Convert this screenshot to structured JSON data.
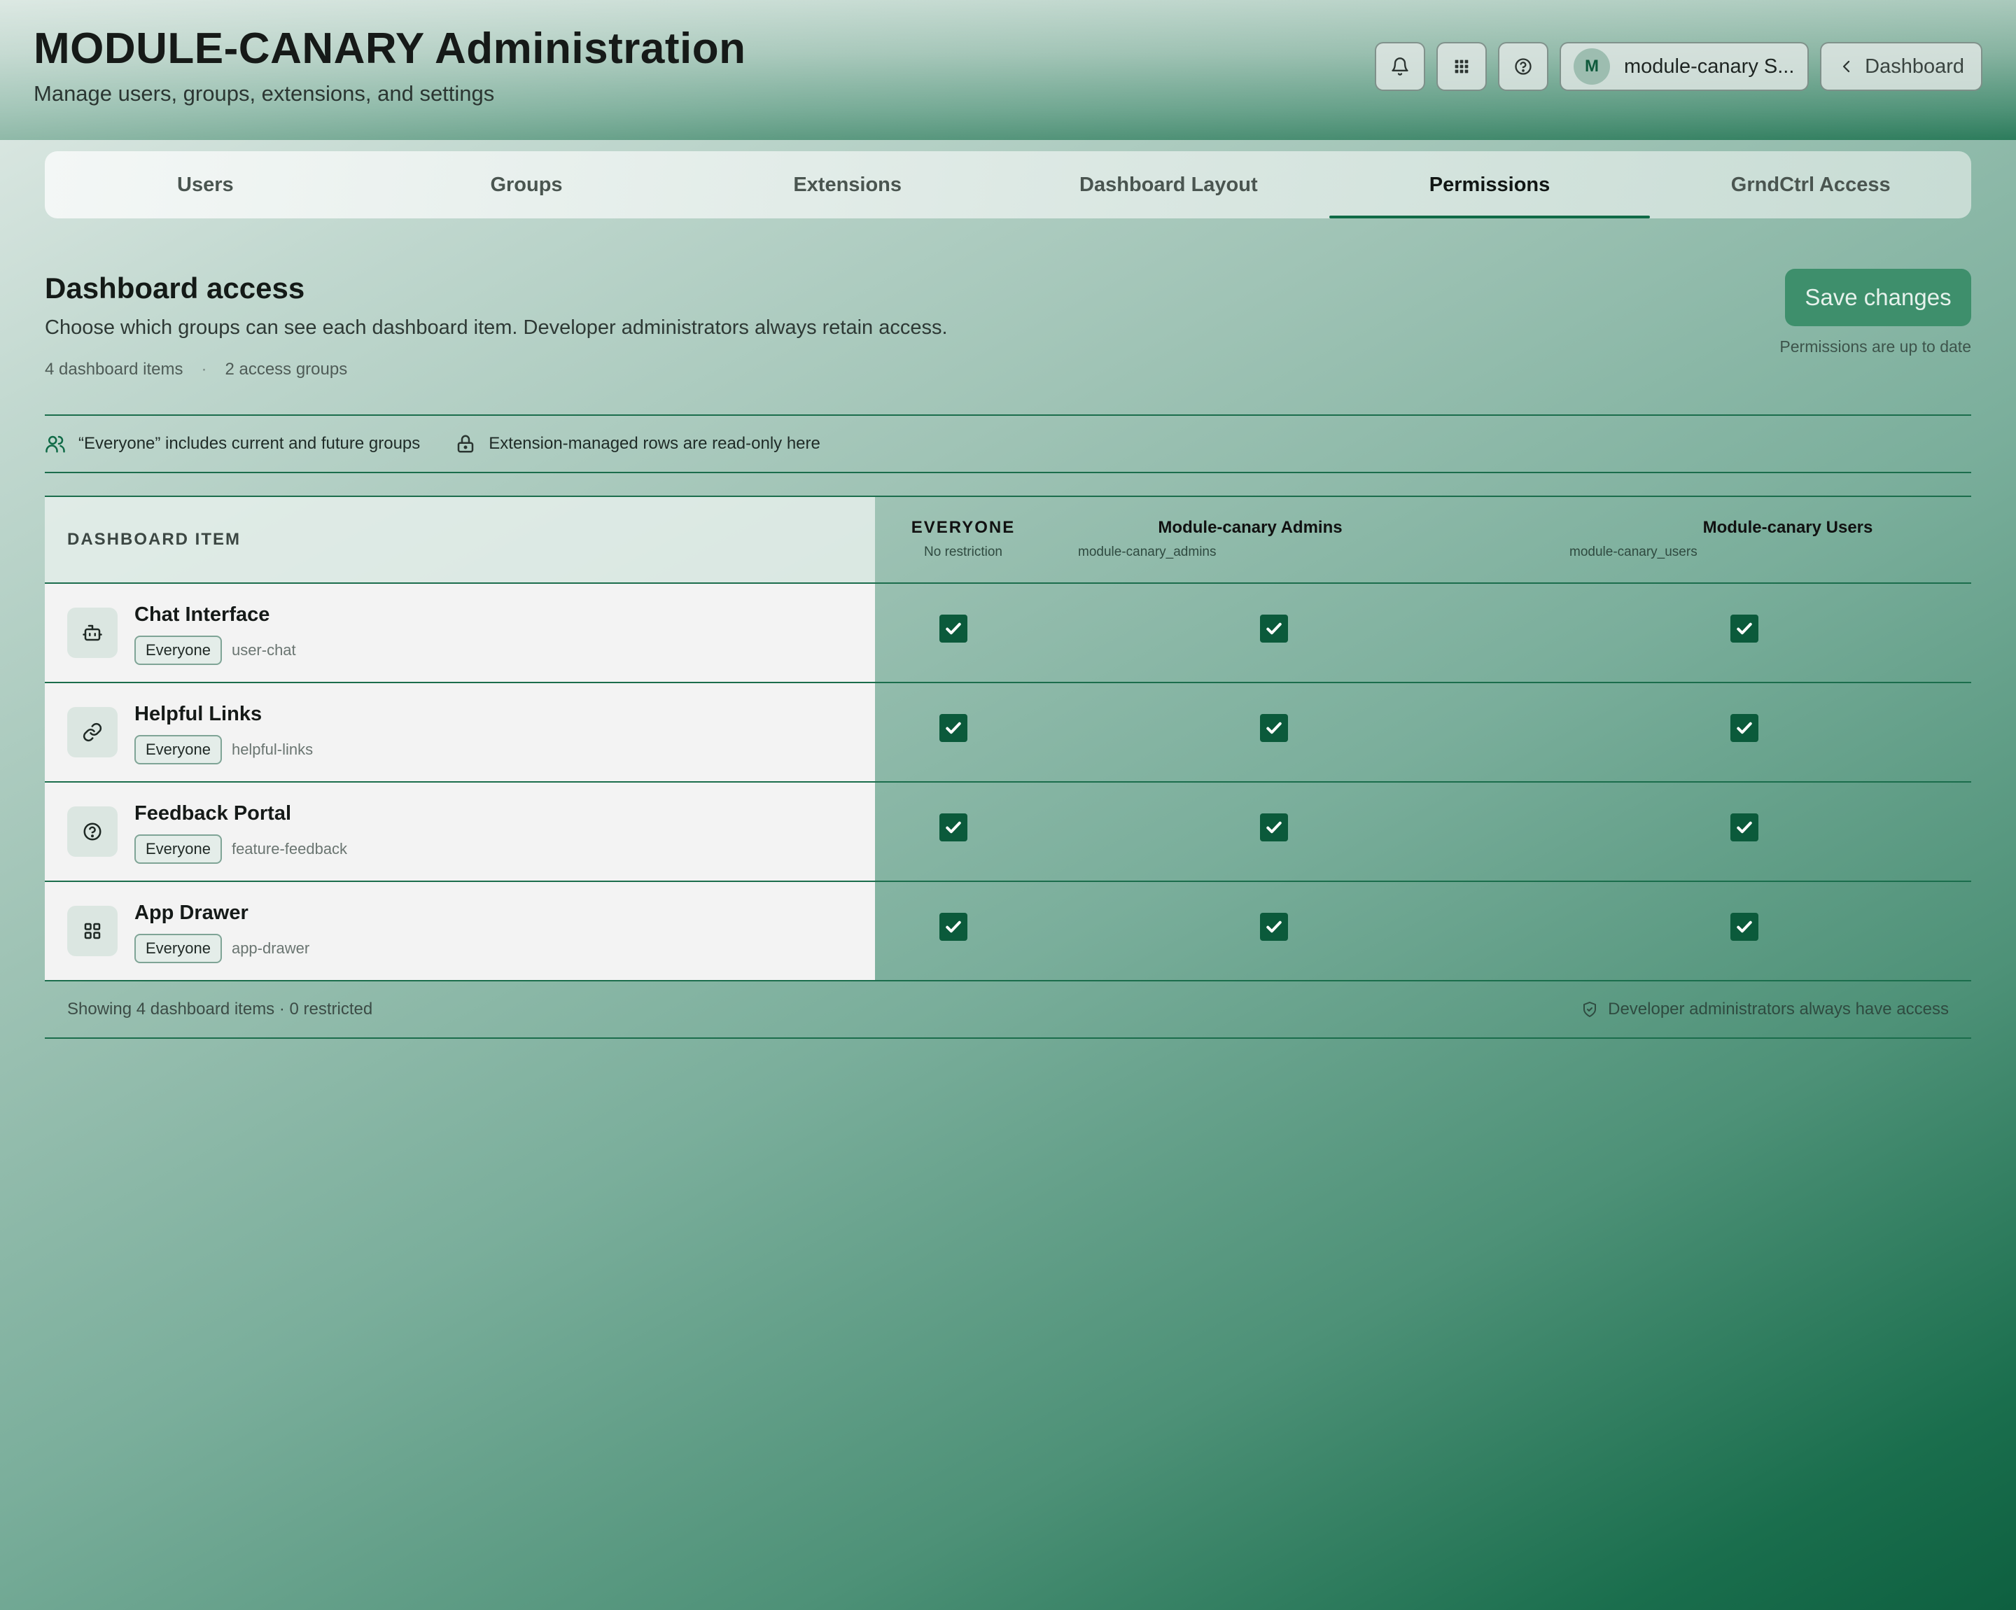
{
  "header": {
    "title": "MODULE-CANARY Administration",
    "subtitle": "Manage users, groups, extensions, and settings",
    "user_initial": "M",
    "user_label": "module-canary S...",
    "dashboard_label": "Dashboard",
    "icons": [
      "bell-icon",
      "grid-icon",
      "help-icon",
      "chevron-left-icon"
    ]
  },
  "tabs": [
    {
      "label": "Users",
      "active": false
    },
    {
      "label": "Groups",
      "active": false
    },
    {
      "label": "Extensions",
      "active": false
    },
    {
      "label": "Dashboard Layout",
      "active": false
    },
    {
      "label": "Permissions",
      "active": true
    },
    {
      "label": "GrndCtrl Access",
      "active": false
    }
  ],
  "section": {
    "title": "Dashboard access",
    "description": "Choose which groups can see each dashboard item. Developer administrators always retain access.",
    "meta_items": "4 dashboard items",
    "meta_sep": "·",
    "meta_groups": "2 access groups",
    "save_label": "Save changes",
    "save_status": "Permissions are up to date"
  },
  "info": {
    "everyone_note": "“Everyone” includes current and future groups",
    "readonly_note": "Extension-managed rows are read-only here"
  },
  "table": {
    "item_header": "DASHBOARD ITEM",
    "columns": [
      {
        "name": "EVERYONE",
        "sub": "No restriction"
      },
      {
        "name": "Module-canary Admins",
        "sub": "module-canary_admins"
      },
      {
        "name": "Module-canary Users",
        "sub": "module-canary_users"
      }
    ],
    "rows": [
      {
        "name": "Chat Interface",
        "badge": "Everyone",
        "slug": "user-chat",
        "icon": "chat-bot-icon",
        "everyone": true,
        "admins": true,
        "users": true
      },
      {
        "name": "Helpful Links",
        "badge": "Everyone",
        "slug": "helpful-links",
        "icon": "link-icon",
        "everyone": true,
        "admins": true,
        "users": true
      },
      {
        "name": "Feedback Portal",
        "badge": "Everyone",
        "slug": "feature-feedback",
        "icon": "help-circle-icon",
        "everyone": true,
        "admins": true,
        "users": true
      },
      {
        "name": "App Drawer",
        "badge": "Everyone",
        "slug": "app-drawer",
        "icon": "grid-icon",
        "everyone": true,
        "admins": true,
        "users": true
      }
    ],
    "footer_left": "Showing 4 dashboard items · 0 restricted",
    "footer_right": "Developer administrators always have access"
  },
  "colors": {
    "accent": "#0f6a46",
    "checkbox": "#0b5a3b",
    "save_button": "#3e8f6c"
  }
}
